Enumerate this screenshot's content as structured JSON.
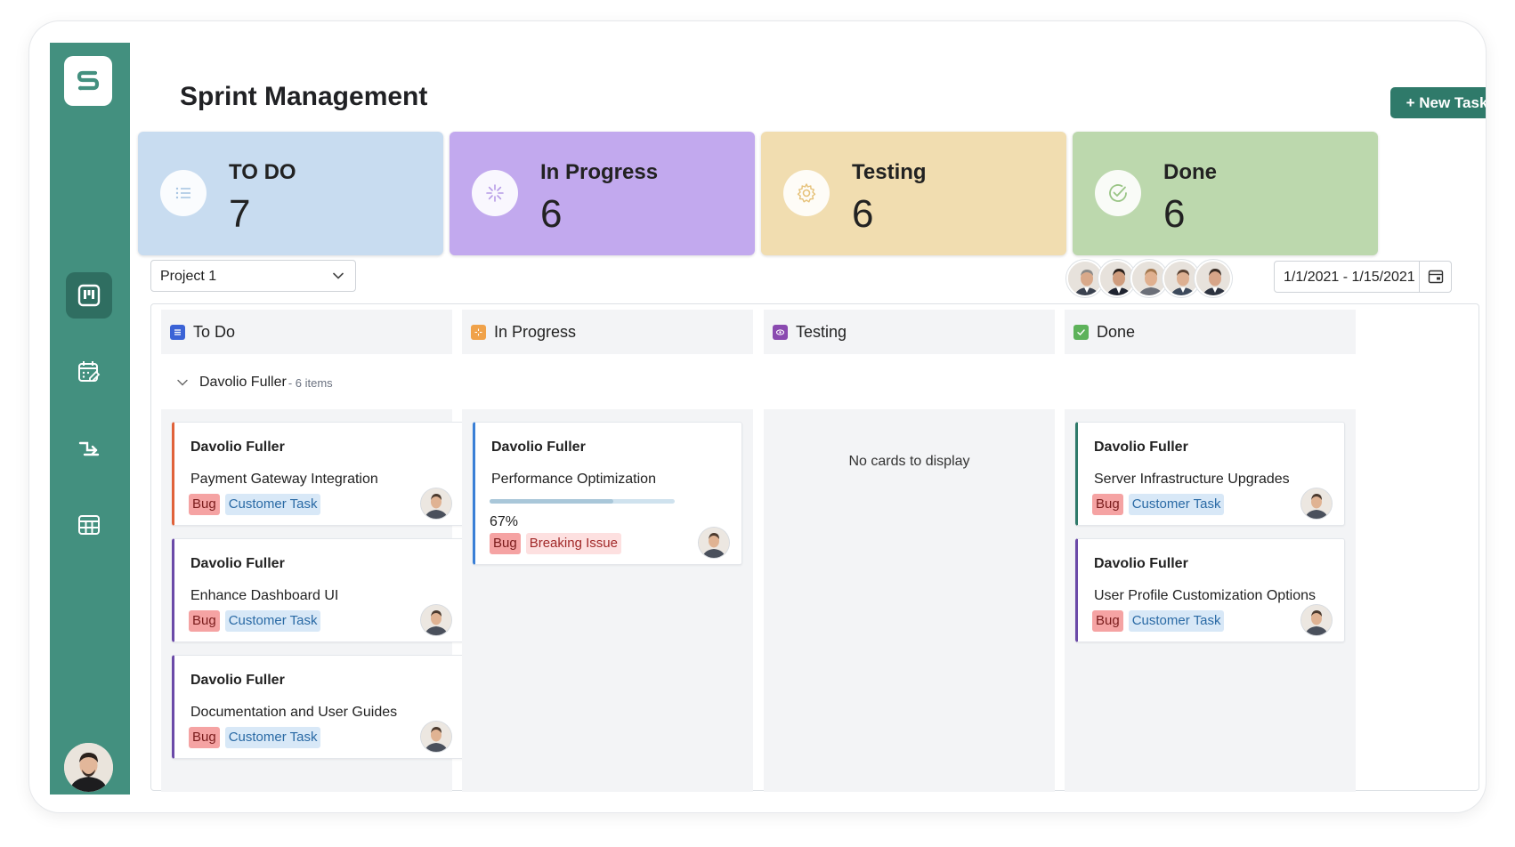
{
  "page": {
    "title": "Sprint Management",
    "new_task_label": "+ New Task"
  },
  "sidebar": {
    "logo_letter": "S",
    "items": [
      {
        "name": "kanban-board-icon",
        "active": true
      },
      {
        "name": "calendar-edit-icon",
        "active": false
      },
      {
        "name": "workflow-icon",
        "active": false
      },
      {
        "name": "table-grid-icon",
        "active": false
      }
    ]
  },
  "stats": [
    {
      "label": "TO DO",
      "value": "7",
      "color": "#c8dcf0",
      "icon": "list-icon"
    },
    {
      "label": "In Progress",
      "value": "6",
      "color": "#c2a9ee",
      "icon": "spinner-icon"
    },
    {
      "label": "Testing",
      "value": "6",
      "color": "#f1ddb0",
      "icon": "gear-icon"
    },
    {
      "label": "Done",
      "value": "6",
      "color": "#bcd8ad",
      "icon": "check-circle-icon"
    }
  ],
  "filters": {
    "project": "Project 1",
    "date_range": "1/1/2021 - 1/15/2021"
  },
  "columns": [
    {
      "label": "To Do",
      "icon_color": "#3b63d6",
      "icon": "list-square-icon"
    },
    {
      "label": "In Progress",
      "icon_color": "#f0a24a",
      "icon": "spinner-square-icon"
    },
    {
      "label": "Testing",
      "icon_color": "#8a4ab0",
      "icon": "eye-square-icon"
    },
    {
      "label": "Done",
      "icon_color": "#5db25a",
      "icon": "check-square-icon"
    }
  ],
  "swimlane": {
    "name": "Davolio Fuller",
    "count": "- 6 items"
  },
  "cards": {
    "todo": [
      {
        "assignee": "Davolio Fuller",
        "title": "Payment Gateway Integration",
        "tags": [
          "Bug",
          "Customer Task"
        ],
        "accent": "#e0623a"
      },
      {
        "assignee": "Davolio Fuller",
        "title": "Enhance Dashboard UI",
        "tags": [
          "Bug",
          "Customer Task"
        ],
        "accent": "#6b4aa8"
      },
      {
        "assignee": "Davolio Fuller",
        "title": "Documentation and User Guides",
        "tags": [
          "Bug",
          "Customer Task"
        ],
        "accent": "#6b4aa8"
      }
    ],
    "inprogress": [
      {
        "assignee": "Davolio Fuller",
        "title": "Performance Optimization",
        "progress_percent": 67,
        "progress_label": "67%",
        "tags": [
          "Bug",
          "Breaking Issue"
        ],
        "accent": "#3a7fd6"
      }
    ],
    "testing_empty": "No cards to display",
    "done": [
      {
        "assignee": "Davolio Fuller",
        "title": "Server Infrastructure Upgrades",
        "tags": [
          "Bug",
          "Customer Task"
        ],
        "accent": "#2f7a6a"
      },
      {
        "assignee": "Davolio Fuller",
        "title": "User Profile Customization Options",
        "tags": [
          "Bug",
          "Customer Task"
        ],
        "accent": "#6b4aa8"
      }
    ]
  }
}
